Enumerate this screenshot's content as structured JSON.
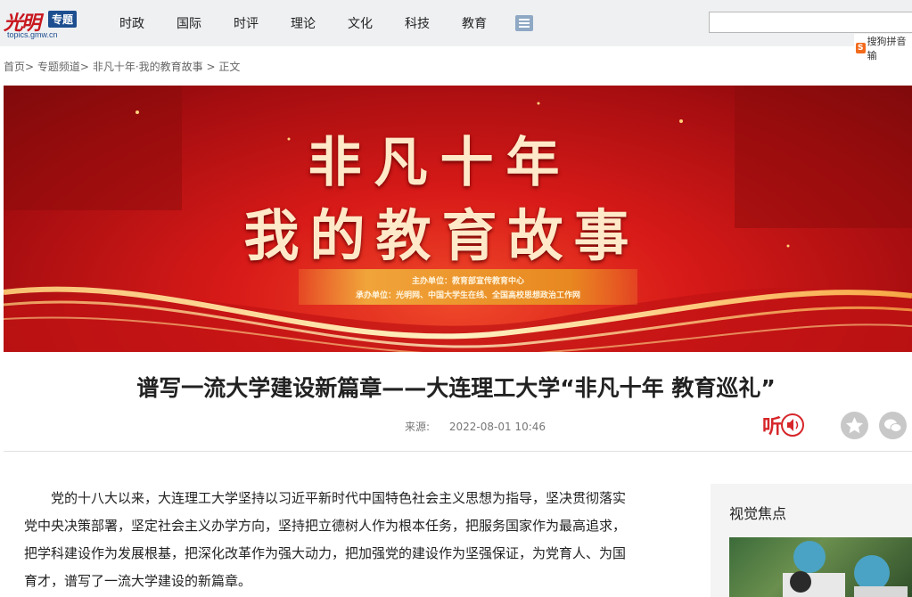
{
  "header": {
    "logo": {
      "script": "光明",
      "badge": "专题",
      "url": "topics.gmw.cn"
    },
    "nav": [
      "时政",
      "国际",
      "时评",
      "理论",
      "文化",
      "科技",
      "教育"
    ],
    "search_placeholder": "",
    "ime_label": "搜狗拼音输"
  },
  "breadcrumb": {
    "items": [
      "首页",
      "专题频道",
      "非凡十年·我的教育故事",
      "正文"
    ],
    "separator": ">"
  },
  "banner": {
    "title_line1": "非凡十年",
    "title_line2": "我的教育故事",
    "organizer": "主办单位：教育部宣传教育中心",
    "co_organizer": "承办单位：光明网、中国大学生在线、全国高校思想政治工作网"
  },
  "article": {
    "title": "谱写一流大学建设新篇章——大连理工大学“非凡十年 教育巡礼”",
    "source_label": "来源:",
    "datetime": "2022-08-01 10:46",
    "listen_label": "听",
    "body": "党的十八大以来，大连理工大学坚持以习近平新时代中国特色社会主义思想为指导，坚决贯彻落实党中央决策部署，坚定社会主义办学方向，坚持把立德树人作为根本任务，把服务国家作为最高追求，把学科建设作为发展根基，把深化改革作为强大动力，把加强党的建设作为坚强保证，为党育人、为国育才，谱写了一流大学建设的新篇章。"
  },
  "sidebar": {
    "title": "视觉焦点"
  },
  "colors": {
    "brand_red": "#c8161d",
    "banner_red": "#d81a18",
    "badge_blue": "#1d4e8f"
  }
}
